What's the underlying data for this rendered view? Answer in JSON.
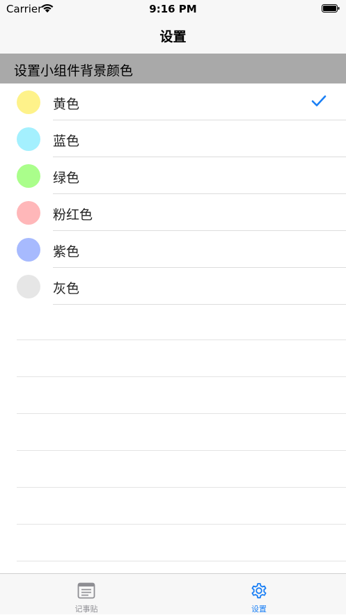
{
  "status_bar": {
    "carrier": "Carrier",
    "time": "9:16 PM"
  },
  "nav": {
    "title": "设置"
  },
  "section": {
    "title": "设置小组件背景颜色"
  },
  "colors": [
    {
      "label": "黄色",
      "color": "#fef28a",
      "selected": true
    },
    {
      "label": "蓝色",
      "color": "#a4f0fe",
      "selected": false
    },
    {
      "label": "绿色",
      "color": "#aafe8b",
      "selected": false
    },
    {
      "label": "粉红色",
      "color": "#ffb7b9",
      "selected": false
    },
    {
      "label": "紫色",
      "color": "#a7bafe",
      "selected": false
    },
    {
      "label": "灰色",
      "color": "#e6e6e6",
      "selected": false
    }
  ],
  "tabs": [
    {
      "label": "记事贴",
      "icon": "notes-icon",
      "active": false
    },
    {
      "label": "设置",
      "icon": "gear-icon",
      "active": true
    }
  ],
  "theme": {
    "accent": "#1a7ff5",
    "inactive": "#8e8e93"
  }
}
